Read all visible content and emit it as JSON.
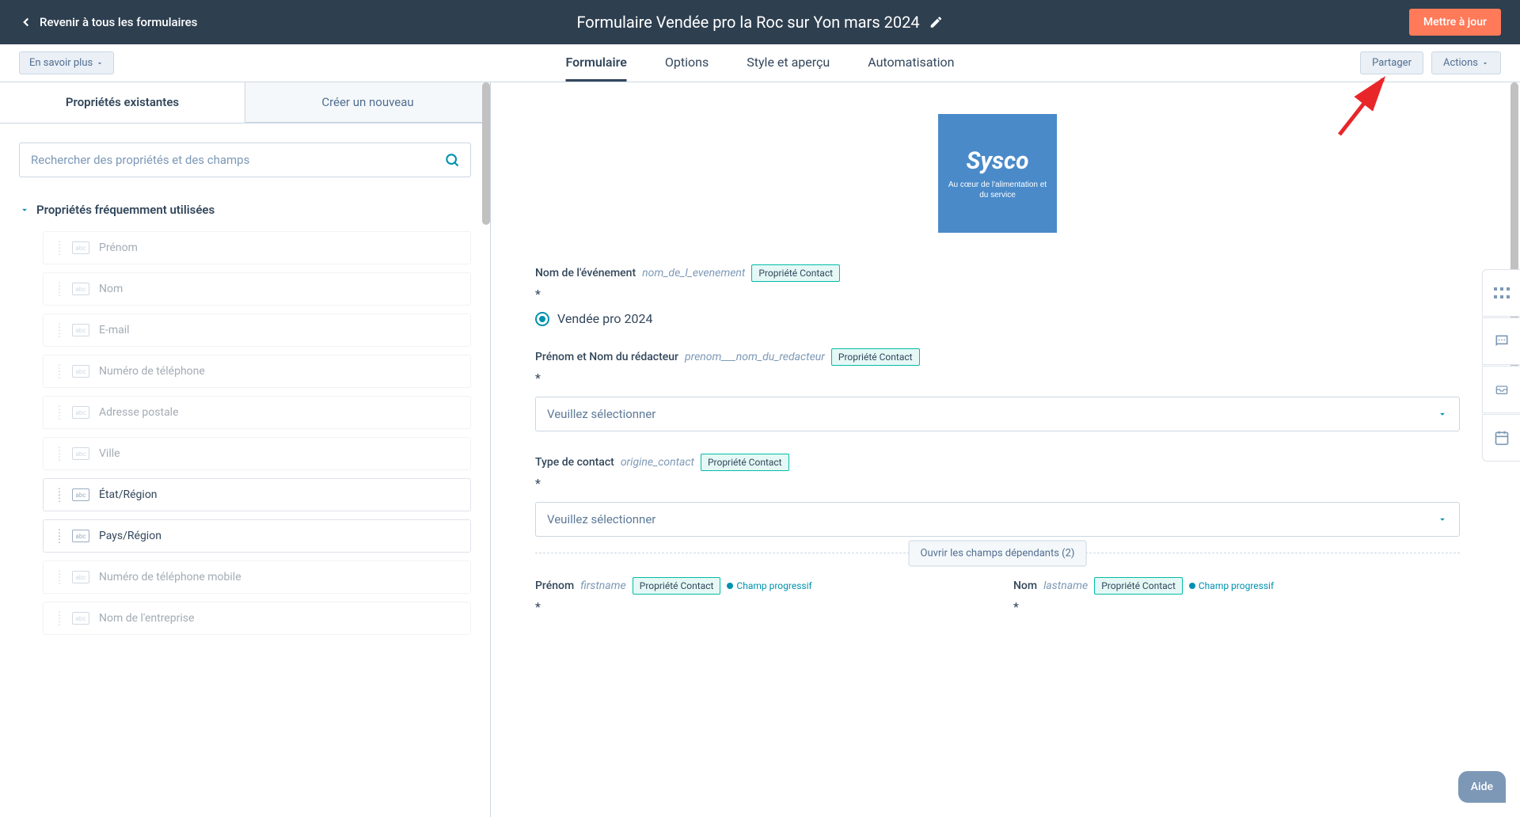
{
  "header": {
    "back_label": "Revenir à tous les formulaires",
    "title": "Formulaire Vendée pro la Roc sur Yon mars 2024",
    "update_label": "Mettre à jour"
  },
  "subnav": {
    "learn_more": "En savoir plus",
    "tabs": [
      "Formulaire",
      "Options",
      "Style et aperçu",
      "Automatisation"
    ],
    "share": "Partager",
    "actions": "Actions"
  },
  "left_panel": {
    "tab_existing": "Propriétés existantes",
    "tab_create": "Créer un nouveau",
    "search_placeholder": "Rechercher des propriétés et des champs",
    "section_title": "Propriétés fréquemment utilisées",
    "properties": [
      {
        "label": "Prénom",
        "enabled": false
      },
      {
        "label": "Nom",
        "enabled": false
      },
      {
        "label": "E-mail",
        "enabled": false
      },
      {
        "label": "Numéro de téléphone",
        "enabled": false
      },
      {
        "label": "Adresse postale",
        "enabled": false
      },
      {
        "label": "Ville",
        "enabled": false
      },
      {
        "label": "État/Région",
        "enabled": true
      },
      {
        "label": "Pays/Région",
        "enabled": true
      },
      {
        "label": "Numéro de téléphone mobile",
        "enabled": false
      },
      {
        "label": "Nom de l'entreprise",
        "enabled": false
      }
    ]
  },
  "logo": {
    "brand": "Sysco",
    "tagline": "Au cœur de l'alimentation et du service"
  },
  "form_fields": {
    "event_name": {
      "label": "Nom de l'événement",
      "api": "nom_de_l_evenement",
      "badge": "Propriété Contact",
      "option": "Vendée pro 2024"
    },
    "redactor": {
      "label": "Prénom et Nom du rédacteur",
      "api": "prenom___nom_du_redacteur",
      "badge": "Propriété Contact",
      "placeholder": "Veuillez sélectionner"
    },
    "contact_type": {
      "label": "Type de contact",
      "api": "origine_contact",
      "badge": "Propriété Contact",
      "placeholder": "Veuillez sélectionner",
      "dependent_label": "Ouvrir les champs dépendants (2)"
    },
    "firstname": {
      "label": "Prénom",
      "api": "firstname",
      "badge": "Propriété Contact",
      "progressive": "Champ progressif"
    },
    "lastname": {
      "label": "Nom",
      "api": "lastname",
      "badge": "Propriété Contact",
      "progressive": "Champ progressif"
    }
  },
  "help_label": "Aide",
  "asterisk": "*"
}
